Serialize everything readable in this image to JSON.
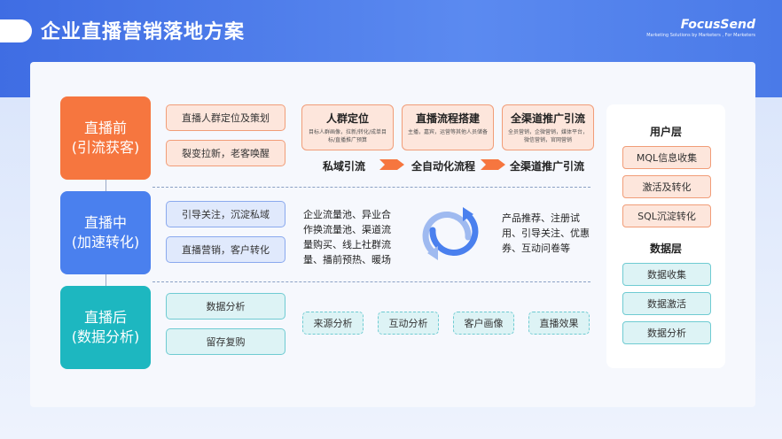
{
  "header": {
    "title": "企业直播营销落地方案",
    "logo_name": "FocusSend",
    "logo_tagline": "Marketing Solutions by Marketers , For Marketers"
  },
  "stages": [
    {
      "line1": "直播前",
      "line2": "(引流获客)",
      "color": "#f6763f"
    },
    {
      "line1": "直播中",
      "line2": "(加速转化)",
      "color": "#4a80ee"
    },
    {
      "line1": "直播后",
      "line2": "(数据分析)",
      "color": "#1db7c0"
    }
  ],
  "pre": {
    "items": [
      "直播人群定位及策划",
      "裂变拉新，老客唤醒"
    ],
    "features": [
      {
        "title": "人群定位",
        "desc": "目标人群画像，拉新/转化/成单目标/直播推广预算"
      },
      {
        "title": "直播流程搭建",
        "desc": "主播，嘉宾，运营等其他人员储备"
      },
      {
        "title": "全渠道推广引流",
        "desc": "全员营销，企微营销，媒体平台，微信营销，官网营销"
      }
    ],
    "flow": [
      "私域引流",
      "全自动化流程",
      "全渠道推广引流"
    ]
  },
  "during": {
    "items": [
      "引导关注，沉淀私域",
      "直播营销，客户转化"
    ],
    "left_text": "企业流量池、异业合作换流量池、渠道流量购买、线上社群流量、播前预热、暖场",
    "right_text": "产品推荐、注册试用、引导关注、优惠券、互动问卷等"
  },
  "post": {
    "items": [
      "数据分析",
      "留存复购"
    ],
    "tags": [
      "来源分析",
      "互动分析",
      "客户画像",
      "直播效果"
    ]
  },
  "sidebar": {
    "user_layer_title": "用户层",
    "user_layer_items": [
      "MQL信息收集",
      "激活及转化",
      "SQL沉淀转化"
    ],
    "data_layer_title": "数据层",
    "data_layer_items": [
      "数据收集",
      "数据激活",
      "数据分析"
    ]
  },
  "colors": {
    "header_blue": "#4a7ae8",
    "orange": "#f6763f",
    "blue": "#4a80ee",
    "teal": "#1db7c0"
  }
}
